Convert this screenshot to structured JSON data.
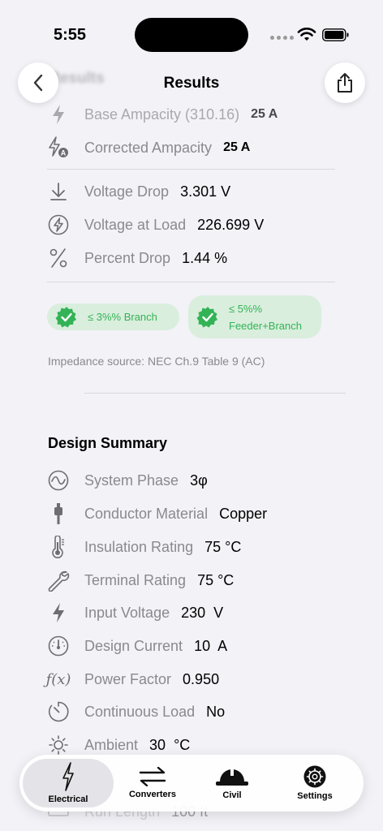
{
  "status_bar": {
    "time": "5:55"
  },
  "nav": {
    "title": "Results",
    "ghost_title": "Results"
  },
  "ampacity": {
    "base_label": "Base Ampacity (310.16)",
    "base_value": "25 A",
    "corrected_label": "Corrected Ampacity",
    "corrected_value": "25 A"
  },
  "voltage": {
    "drop_label": "Voltage Drop",
    "drop_value": "3.301 V",
    "load_label": "Voltage at Load",
    "load_value": "226.699 V",
    "percent_label": "Percent Drop",
    "percent_value": "1.44 %"
  },
  "badges": {
    "branch": "≤ 3%% Branch",
    "feeder_line1": "≤ 5%%",
    "feeder_line2": "Feeder+Branch"
  },
  "impedance_note": "Impedance source: NEC Ch.9 Table 9 (AC)",
  "design_summary": {
    "title": "Design Summary",
    "system_phase_label": "System Phase",
    "system_phase_value": "3φ",
    "conductor_material_label": "Conductor Material",
    "conductor_material_value": "Copper",
    "insulation_rating_label": "Insulation Rating",
    "insulation_rating_value": "75 °C",
    "terminal_rating_label": "Terminal Rating",
    "terminal_rating_value": "75 °C",
    "input_voltage_label": "Input Voltage",
    "input_voltage_value": "230  V",
    "design_current_label": "Design Current",
    "design_current_value": "10  A",
    "power_factor_label": "Power Factor",
    "power_factor_value": "0.950",
    "continuous_load_label": "Continuous Load",
    "continuous_load_value": "No",
    "ambient_label": "Ambient",
    "ambient_value": "30  °C",
    "run_length_label": "Run Length",
    "run_length_value": "100 ft"
  },
  "tabs": {
    "electrical": "Electrical",
    "converters": "Converters",
    "civil": "Civil",
    "settings": "Settings"
  },
  "colors": {
    "accent_green": "#34b356",
    "badge_bg": "#d9eedd",
    "background": "#f2f2f7"
  }
}
